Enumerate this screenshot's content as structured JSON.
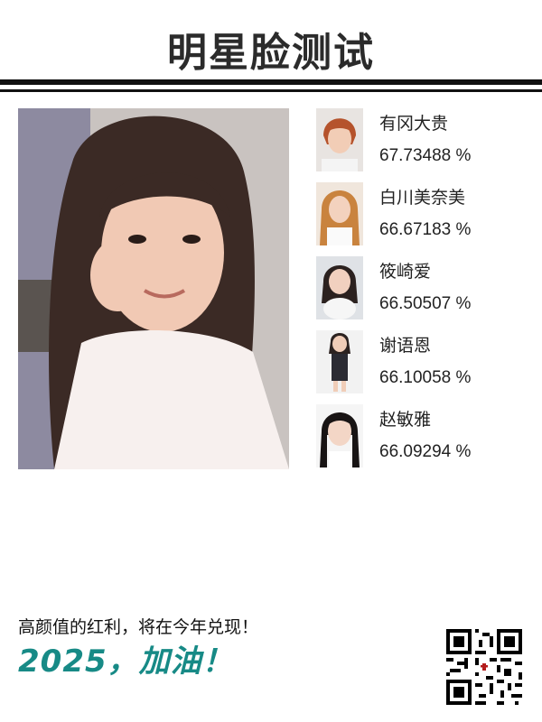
{
  "title": "明星脸测试",
  "slogan": "高颜值的红利，将在今年兑现！",
  "motto": "2025，加油！",
  "matches": [
    {
      "name": "有冈大贵",
      "score": "67.73488 %"
    },
    {
      "name": "白川美奈美",
      "score": "66.67183 %"
    },
    {
      "name": "筱崎爱",
      "score": "66.50507 %"
    },
    {
      "name": "谢语恩",
      "score": "66.10058 %"
    },
    {
      "name": "赵敏雅",
      "score": "66.09294 %"
    }
  ],
  "colors": {
    "accent": "#178a86",
    "rule": "#111111"
  },
  "icons": {
    "qr": "qr-code-icon"
  }
}
